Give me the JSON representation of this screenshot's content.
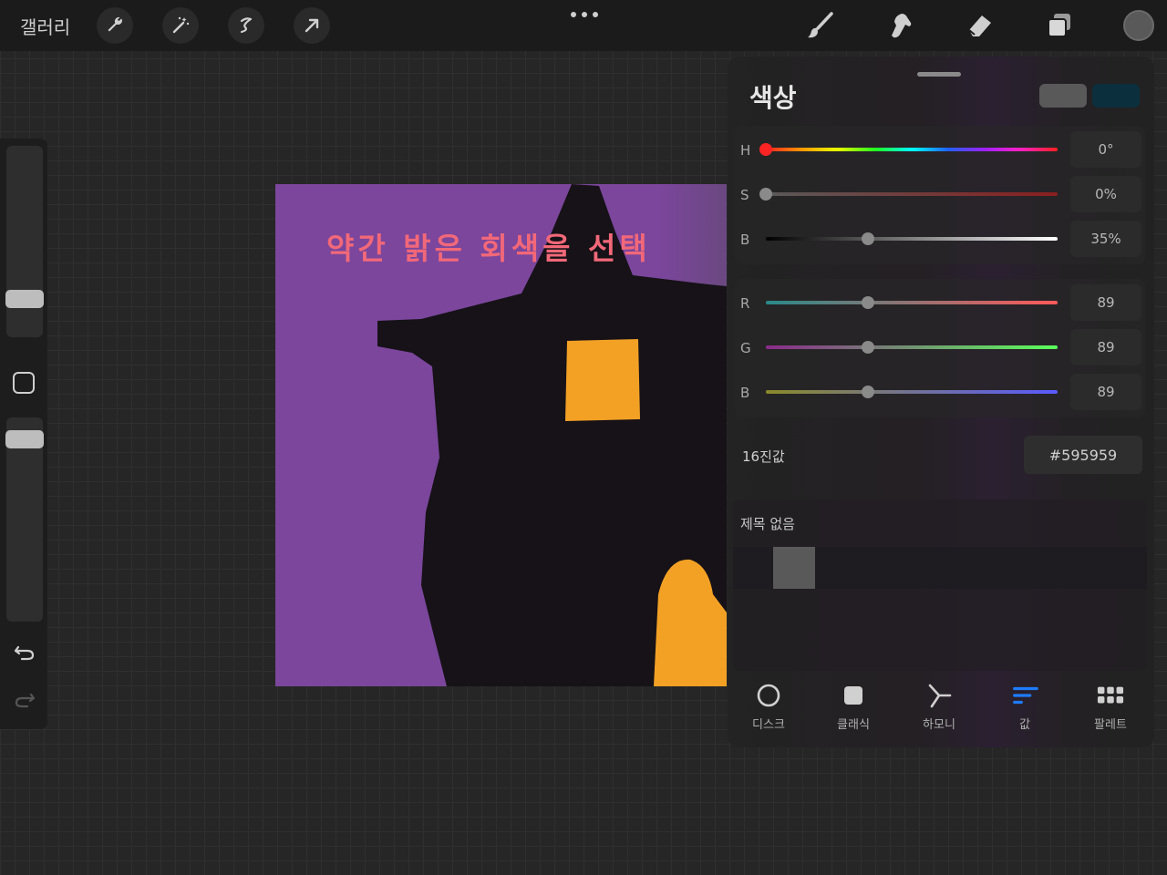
{
  "topbar": {
    "gallery_label": "갤러리",
    "left_tools": [
      "wrench-icon",
      "magic-wand-icon",
      "selection-icon",
      "transform-arrow-icon"
    ],
    "right_tools": [
      "brush-icon",
      "smudge-icon",
      "eraser-icon",
      "layers-icon"
    ],
    "current_color": "#595959"
  },
  "canvas": {
    "annotation": "약간 밝은 회색을 선택",
    "background_color": "#7b469c"
  },
  "color_panel": {
    "title": "색상",
    "current_color": "#595959",
    "previous_color": "#0b2f3d",
    "hsb": [
      {
        "label": "H",
        "value": "0°",
        "fraction": 0.0
      },
      {
        "label": "S",
        "value": "0%",
        "fraction": 0.0
      },
      {
        "label": "B",
        "value": "35%",
        "fraction": 0.35
      }
    ],
    "rgb": [
      {
        "label": "R",
        "value": "89",
        "fraction": 0.35
      },
      {
        "label": "G",
        "value": "89",
        "fraction": 0.35
      },
      {
        "label": "B",
        "value": "89",
        "fraction": 0.35
      }
    ],
    "hex_label": "16진값",
    "hex_value": "#595959",
    "palette_name": "제목 없음",
    "palette_colors": [
      "#595959"
    ],
    "tabs": [
      {
        "label": "디스크",
        "icon": "disc-icon"
      },
      {
        "label": "클래식",
        "icon": "classic-square-icon"
      },
      {
        "label": "하모니",
        "icon": "harmony-icon"
      },
      {
        "label": "값",
        "icon": "value-sliders-icon",
        "active": true
      },
      {
        "label": "팔레트",
        "icon": "palette-grid-icon"
      }
    ]
  }
}
